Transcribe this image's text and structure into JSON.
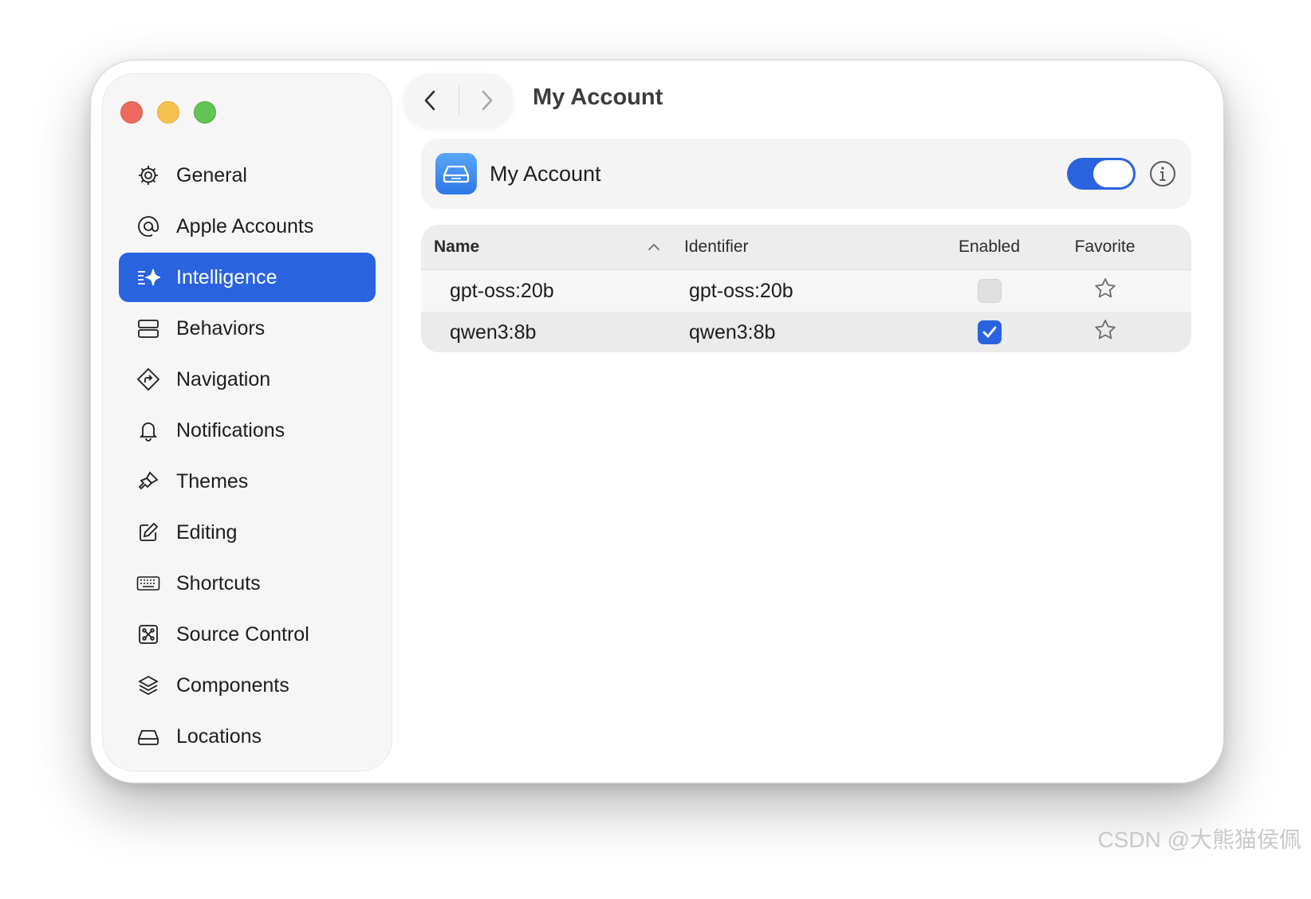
{
  "window": {
    "traffic_lights": [
      "close",
      "minimize",
      "zoom"
    ],
    "title": "My Account"
  },
  "sidebar": {
    "items": [
      {
        "label": "General",
        "icon": "gear-icon",
        "active": false
      },
      {
        "label": "Apple Accounts",
        "icon": "at-icon",
        "active": false
      },
      {
        "label": "Intelligence",
        "icon": "sparkle-icon",
        "active": true
      },
      {
        "label": "Behaviors",
        "icon": "stack-rect-icon",
        "active": false
      },
      {
        "label": "Navigation",
        "icon": "diamond-arrow-icon",
        "active": false
      },
      {
        "label": "Notifications",
        "icon": "bell-icon",
        "active": false
      },
      {
        "label": "Themes",
        "icon": "paintbrush-icon",
        "active": false
      },
      {
        "label": "Editing",
        "icon": "pencil-square-icon",
        "active": false
      },
      {
        "label": "Shortcuts",
        "icon": "keyboard-icon",
        "active": false
      },
      {
        "label": "Source Control",
        "icon": "source-control-icon",
        "active": false
      },
      {
        "label": "Components",
        "icon": "layers-icon",
        "active": false
      },
      {
        "label": "Locations",
        "icon": "drive-icon",
        "active": false
      }
    ]
  },
  "account": {
    "name": "My Account",
    "icon": "drive-icon",
    "enabled": true
  },
  "table": {
    "headers": {
      "name": "Name",
      "identifier": "Identifier",
      "enabled": "Enabled",
      "favorite": "Favorite"
    },
    "sort": "ascending",
    "rows": [
      {
        "name": "gpt-oss:20b",
        "identifier": "gpt-oss:20b",
        "enabled": false,
        "favorite": false
      },
      {
        "name": "qwen3:8b",
        "identifier": "qwen3:8b",
        "enabled": true,
        "favorite": false
      }
    ]
  },
  "watermark": "CSDN @大熊猫侯佩",
  "colors": {
    "accent": "#2a63e0",
    "close": "#ed6a5e",
    "minimize": "#f5c24f",
    "zoom": "#61c454"
  }
}
